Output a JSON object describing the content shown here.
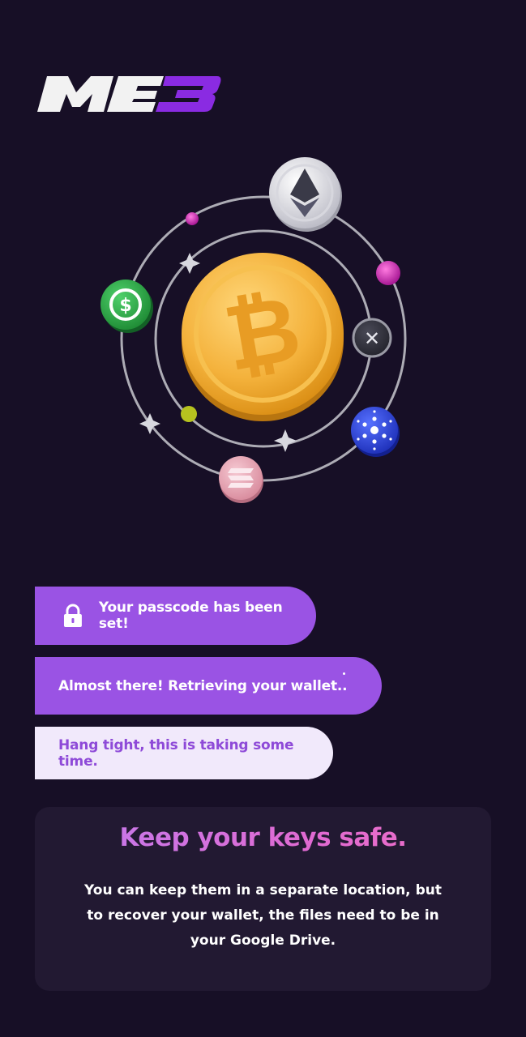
{
  "app": {
    "logo_text": "ME3",
    "logo_colors": {
      "primary": "#f2f2f2",
      "accent": "#8a2be2"
    }
  },
  "hero": {
    "icons": [
      "bitcoin-coin-icon",
      "ethereum-coin-icon",
      "usdc-coin-icon",
      "xrp-coin-icon",
      "cardano-coin-icon",
      "solana-coin-icon",
      "sparkle-icon"
    ]
  },
  "messages": [
    {
      "text": "Your passcode has been set!",
      "icon": "lock-icon"
    },
    {
      "text": "Almost there! Retrieving your wallet.."
    },
    {
      "text": "Hang tight, this is taking some time."
    }
  ],
  "info_card": {
    "title": "Keep your keys safe.",
    "body": "You can keep them in a separate location, but to recover your wallet, the files need to be in your Google Drive."
  },
  "colors": {
    "background": "#170f26",
    "bubble_purple": "#9a53e4",
    "bubble_light": "#f1e9fb",
    "card_bg": "#221932"
  }
}
